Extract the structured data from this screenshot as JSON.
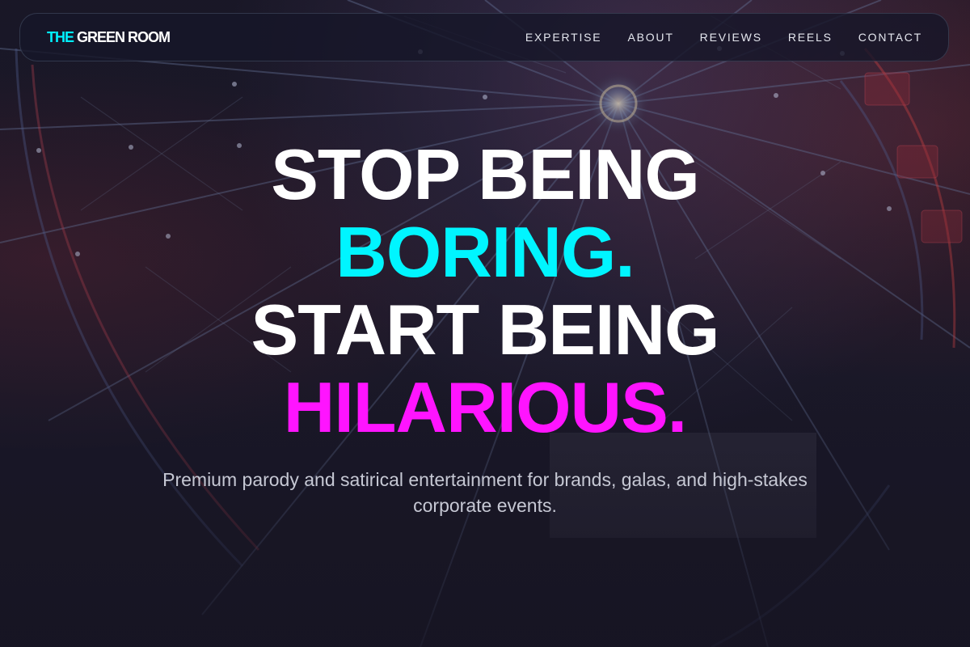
{
  "brand": {
    "logo_accent": "THE",
    "logo_rest": "GREEN ROOM"
  },
  "nav": {
    "items": [
      {
        "label": "EXPERTISE"
      },
      {
        "label": "ABOUT"
      },
      {
        "label": "REVIEWS"
      },
      {
        "label": "REELS"
      },
      {
        "label": "CONTACT"
      }
    ]
  },
  "hero": {
    "line1": "STOP BEING",
    "line2": "BORING.",
    "line3": "START BEING",
    "line4": "HILARIOUS.",
    "subtitle": "Premium parody and satirical entertainment for brands, galas, and high-stakes corporate events.",
    "background_image": "ferris-wheel-night-lights"
  },
  "colors": {
    "accent_cyan": "#00f5ff",
    "accent_magenta": "#ff14ff",
    "background": "#1a1828"
  }
}
